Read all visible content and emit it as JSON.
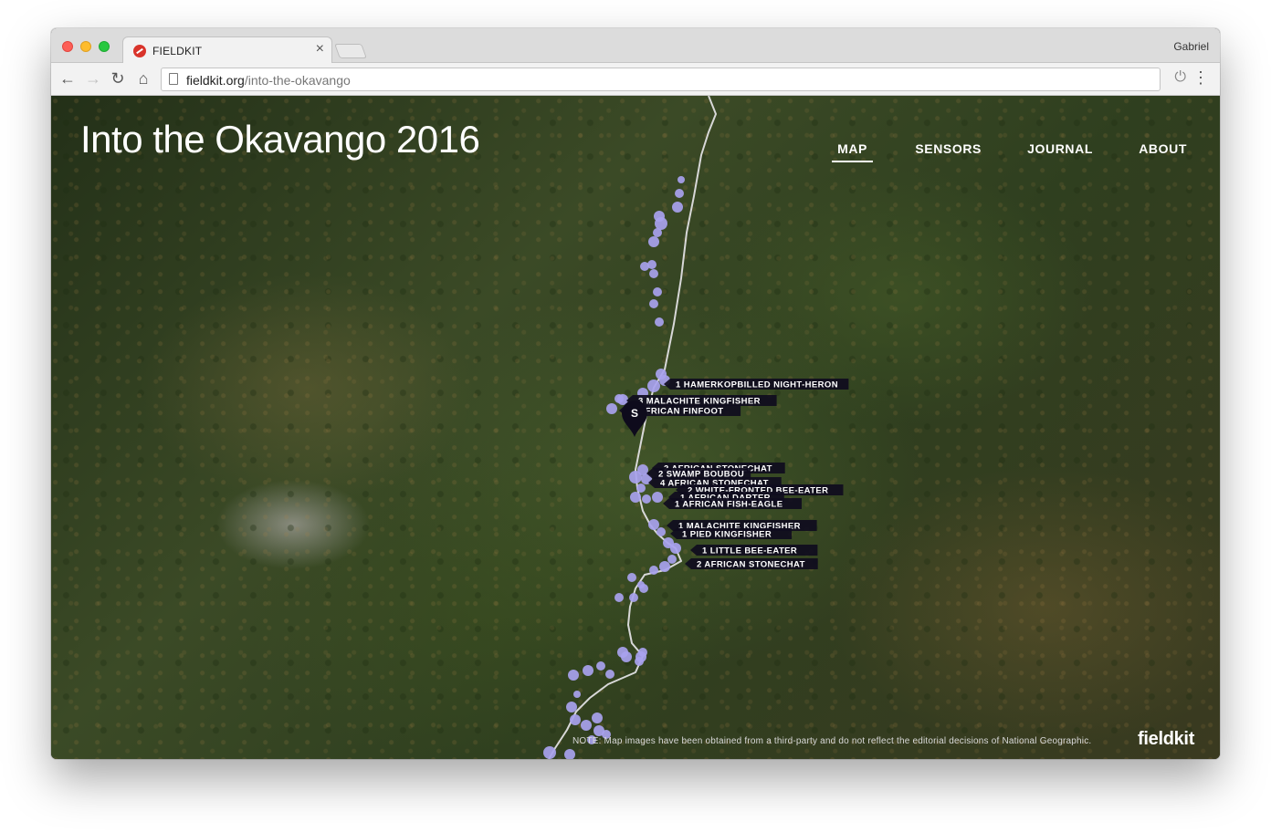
{
  "browser": {
    "tab_title": "FIELDKIT",
    "tab_close": "×",
    "profile_name": "Gabriel",
    "url_host": "fieldkit.org",
    "url_path": "/into-the-okavango",
    "icons": {
      "back": "back-arrow-icon",
      "forward": "forward-arrow-icon",
      "reload": "reload-icon",
      "home": "home-icon",
      "page": "page-icon",
      "extension": "power-icon",
      "menu": "kebab-menu-icon",
      "favicon": "no-entry-favicon-icon"
    }
  },
  "page": {
    "title": "Into the Okavango 2016",
    "nav": [
      {
        "label": "MAP",
        "active": true
      },
      {
        "label": "SENSORS",
        "active": false
      },
      {
        "label": "JOURNAL",
        "active": false
      },
      {
        "label": "ABOUT",
        "active": false
      }
    ],
    "marker_label": "S",
    "note": "NOTE: Map images have been obtained from a third-party and do not reflect the editorial decisions of National Geographic.",
    "brand": "fieldkit",
    "colors": {
      "route_dot": "#a8a2ee",
      "route_line": "#d8d8d8",
      "label_bg": "#0f0c1e",
      "marker": "#0e0b1c"
    },
    "sightings": [
      "1 HAMERKOPBILLED NIGHT-HERON",
      "3 MALACHITE KINGFISHER",
      "2 AFRICAN FINFOOT",
      "2 AFRICAN STONECHAT",
      "2 SWAMP BOUBOU",
      "4 AFRICAN STONECHAT",
      "2 WHITE-FRONTED BEE-EATER",
      "1 AFRICAN DARTER",
      "1 AFRICAN FISH-EAGLE",
      "1 MALACHITE KINGFISHER",
      "1 PIED KINGFISHER",
      "1 LITTLE BEE-EATER",
      "2 AFRICAN STONECHAT"
    ]
  }
}
